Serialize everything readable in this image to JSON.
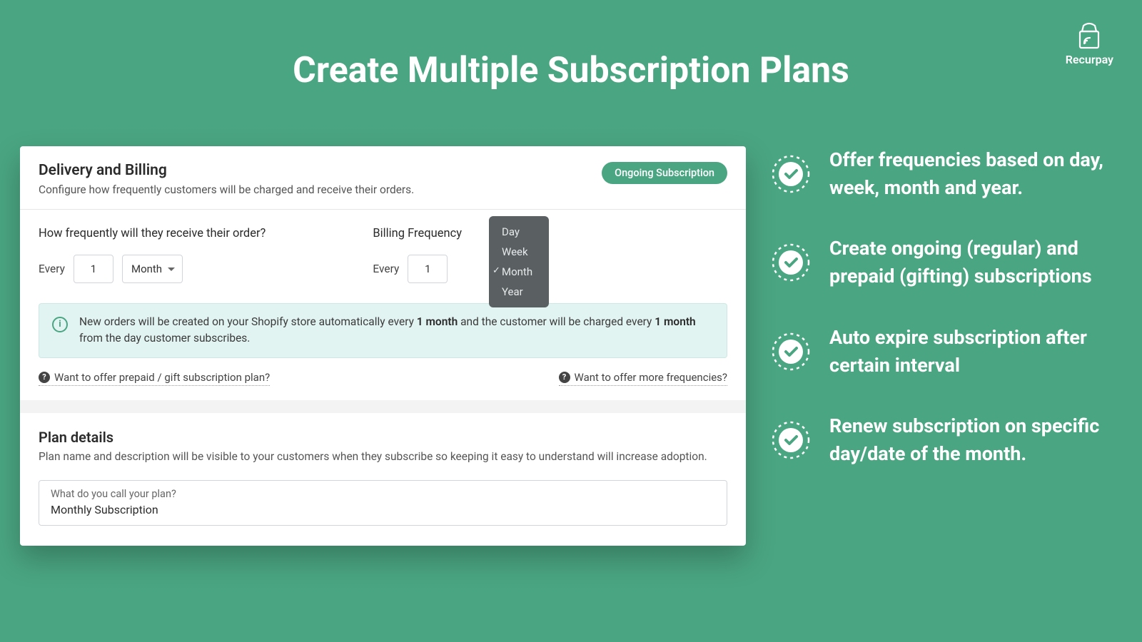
{
  "page": {
    "title": "Create Multiple Subscription Plans"
  },
  "logo": {
    "name": "Recurpay"
  },
  "delivery": {
    "title": "Delivery and Billing",
    "subtitle": "Configure how frequently customers will be charged and receive their orders.",
    "badge": "Ongoing Subscription",
    "order_frequency_label": "How frequently will they receive their order?",
    "billing_frequency_label": "Billing Frequency",
    "every_label": "Every",
    "order_count": "1",
    "order_period": "Month",
    "billing_count": "1",
    "period_options": [
      "Day",
      "Week",
      "Month",
      "Year"
    ],
    "selected_period": "Month",
    "info_text_1": "New orders will be created on your Shopify store automatically every ",
    "info_bold_1": "1 month",
    "info_text_2": " and the customer will be charged every ",
    "info_bold_2": "1 month",
    "info_text_3": " from the day customer subscribes.",
    "help_prepaid": "Want to offer prepaid / gift subscription plan?",
    "help_more": "Want to offer more frequencies?"
  },
  "plan": {
    "title": "Plan details",
    "subtitle": "Plan name and description will be visible to your customers when they subscribe so keeping it easy to understand will increase adoption.",
    "name_label": "What do you call your plan?",
    "name_value": "Monthly Subscription"
  },
  "features": [
    "Offer frequencies based on day, week, month and year.",
    "Create ongoing (regular) and prepaid (gifting) subscriptions",
    "Auto expire subscription after certain interval",
    "Renew subscription on specific day/date of the month."
  ]
}
